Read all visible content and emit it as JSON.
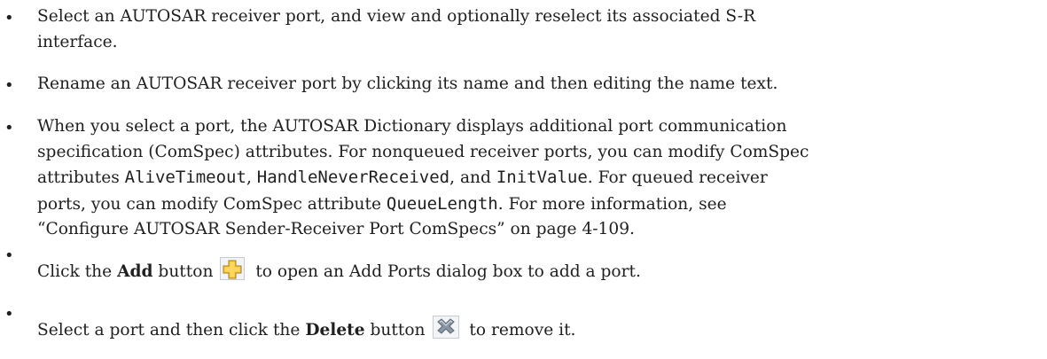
{
  "bullet_glyph": "•",
  "items": [
    {
      "line1": "Select an AUTOSAR receiver port, and view and optionally reselect its associated S-R",
      "line2": "interface."
    },
    {
      "text": "Rename an AUTOSAR receiver port by clicking its name and then editing the name text."
    },
    {
      "line1": "When you select a port, the AUTOSAR Dictionary displays additional port communication",
      "line2": "specification (ComSpec) attributes. For nonqueued receiver ports, you can modify ComSpec",
      "line3_pre": "attributes ",
      "line3_code1": "AliveTimeout",
      "line3_sep1": ", ",
      "line3_code2": "HandleNeverReceived",
      "line3_sep2": ", and ",
      "line3_code3": "InitValue",
      "line3_post": ". For queued receiver",
      "line4_pre": "ports, you can modify ComSpec attribute ",
      "line4_code": "QueueLength",
      "line4_post": ". For more information, see",
      "line5": "“Configure AUTOSAR Sender-Receiver Port ComSpecs” on page 4-109."
    },
    {
      "pre": "Click the ",
      "bold": "Add",
      "mid": " button",
      "icon": "add-port-icon",
      "post": " to open an Add Ports dialog box to add a port."
    },
    {
      "pre": "Select a port and then click the ",
      "bold": "Delete",
      "mid": " button",
      "icon": "delete-port-icon",
      "post": " to remove it."
    }
  ],
  "colors": {
    "text": "#1f1f1f",
    "add_icon_fill": "#f5c53a",
    "add_icon_outline": "#b07d10",
    "delete_icon_fill": "#8a96a3"
  }
}
